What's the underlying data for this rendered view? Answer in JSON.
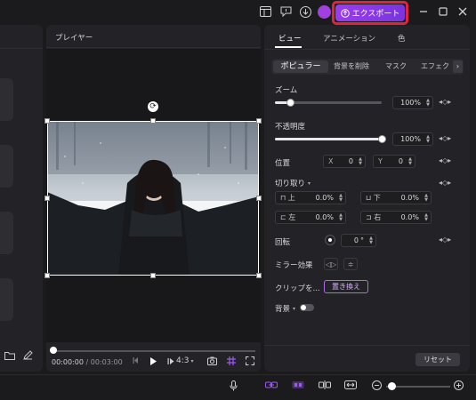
{
  "titlebar": {
    "export_label": "エクスポート"
  },
  "player": {
    "title": "プレイヤー",
    "timecode_current": "00:00:00",
    "timecode_separator": "/",
    "timecode_total": "00:03:00",
    "aspect_ratio": "4:3"
  },
  "inspector": {
    "tabs": [
      "ビュー",
      "アニメーション",
      "色"
    ],
    "subtabs": [
      "ポピュラー",
      "背景を削除",
      "マスク",
      "エフェク"
    ],
    "zoom_label": "ズーム",
    "zoom_value": "100%",
    "zoom_level": 0.14,
    "opacity_label": "不透明度",
    "opacity_value": "100%",
    "opacity_level": 1.0,
    "position_label": "位置",
    "position_x_label": "X",
    "position_x_value": "0",
    "position_y_label": "Y",
    "position_y_value": "0",
    "crop_label": "切り取り",
    "crop_top_label": "上",
    "crop_top_value": "0.0%",
    "crop_bottom_label": "下",
    "crop_bottom_value": "0.0%",
    "crop_left_label": "左",
    "crop_left_value": "0.0%",
    "crop_right_label": "右",
    "crop_right_value": "0.0%",
    "rotation_label": "回転",
    "rotation_value": "0",
    "rotation_unit": "°",
    "mirror_label": "ミラー効果",
    "clip_label": "クリップを...",
    "replace_label": "置き換え",
    "background_label": "背景",
    "reset_label": "リセット"
  },
  "colors": {
    "accent": "#9b3bf0",
    "highlight": "#e0243c"
  }
}
